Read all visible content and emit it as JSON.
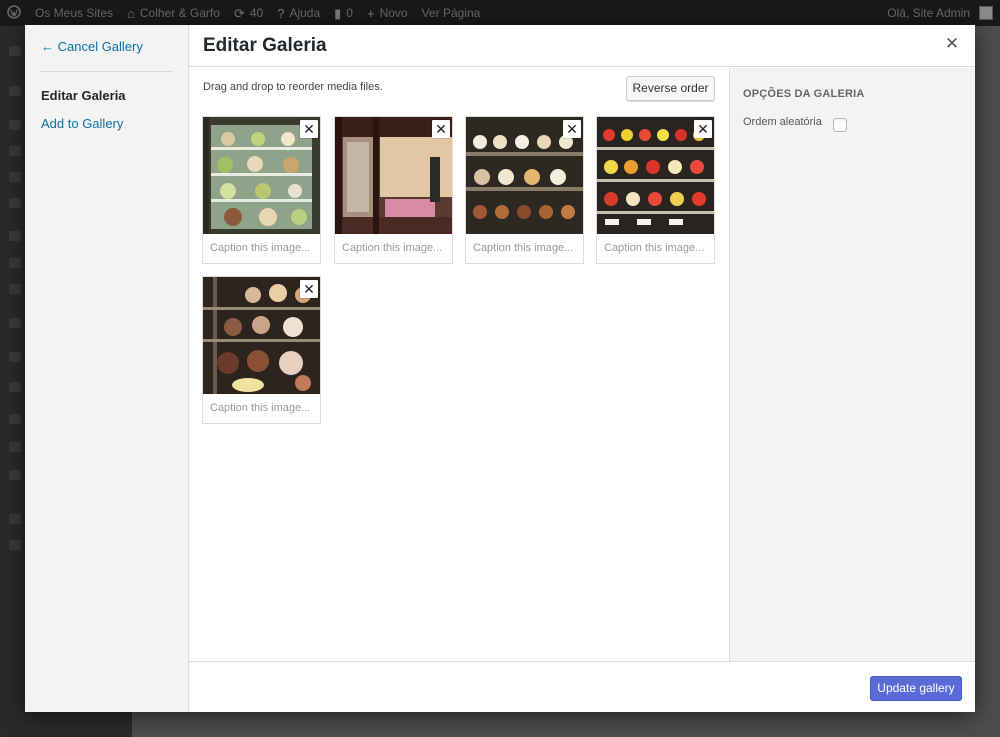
{
  "adminbar": {
    "sites": "Os Meus Sites",
    "site_name": "Colher & Garfo",
    "updates_count": "40",
    "help": "Ajuda",
    "comments_count": "0",
    "new": "Novo",
    "view_page": "Ver Página",
    "greeting": "Olá, Site Admin"
  },
  "menu": {
    "cancel": "← Cancel Gallery",
    "active": "Editar Galeria",
    "add": "Add to Gallery"
  },
  "title": "Editar Galeria",
  "close_glyph": "✕",
  "content": {
    "hint": "Drag and drop to reorder media files.",
    "reverse_label": "Reverse order"
  },
  "thumbnails": [
    {
      "caption_placeholder": "Caption this image...",
      "remove_glyph": "✕",
      "subject": "cake display case"
    },
    {
      "caption_placeholder": "Caption this image...",
      "remove_glyph": "✕",
      "subject": "patisserie interior"
    },
    {
      "caption_placeholder": "Caption this image...",
      "remove_glyph": "✕",
      "subject": "cupcakes on shelves"
    },
    {
      "caption_placeholder": "Caption this image...",
      "remove_glyph": "✕",
      "subject": "strawberry tarts"
    },
    {
      "caption_placeholder": "Caption this image...",
      "remove_glyph": "✕",
      "subject": "cakes in glass case"
    }
  ],
  "sidebar": {
    "heading": "Opções da Galeria",
    "random_order_label": "Ordem aleatória",
    "random_order_checked": false
  },
  "footer": {
    "update_label": "Update gallery"
  },
  "colors": {
    "accent": "#5a6ad7",
    "link": "#0a73aa",
    "adminbar": "#191919"
  }
}
